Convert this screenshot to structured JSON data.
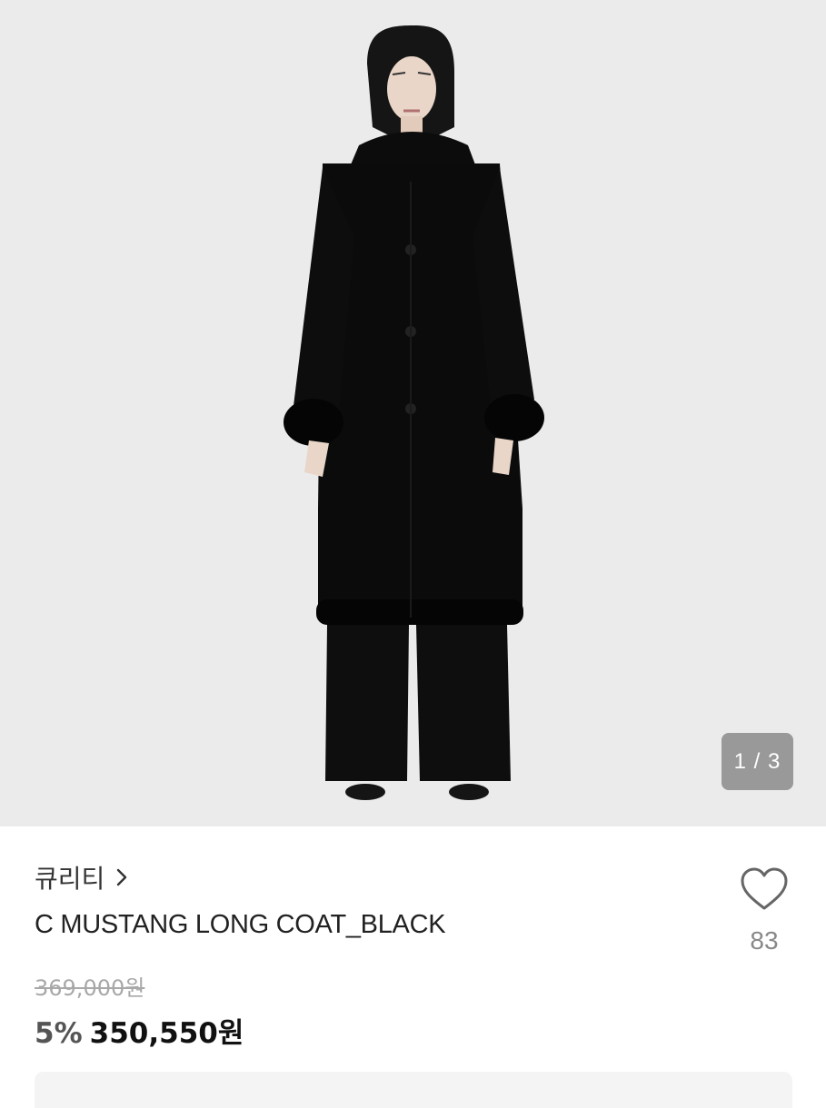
{
  "gallery": {
    "counter": "1 / 3",
    "image_icon": "product-photo-coat-model"
  },
  "product": {
    "brand": "큐리티",
    "brand_link_icon": "chevron-right-icon",
    "name": "C MUSTANG LONG COAT_BLACK",
    "original_price": "369,000원",
    "discount": "5%",
    "sale_price": "350,550원"
  },
  "like": {
    "icon": "heart-outline-icon",
    "count": "83"
  },
  "colors": {
    "background": "#ebebeb",
    "text_primary": "#222222",
    "text_muted": "#888888"
  }
}
